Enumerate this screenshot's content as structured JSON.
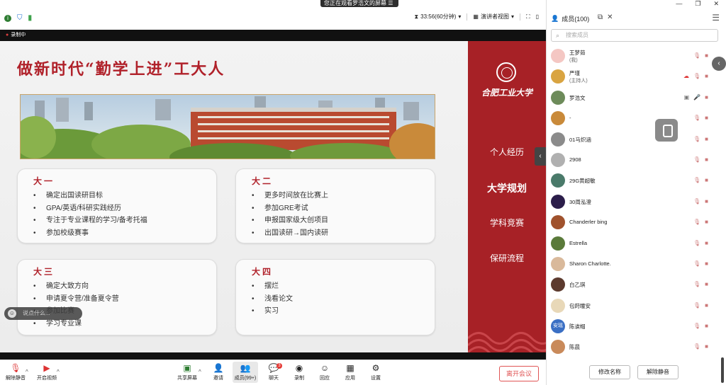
{
  "top": {
    "share_banner": "您正在观看罗浩文的屏幕",
    "duration": "33:56(60分钟)",
    "view_mode": "演讲者视图"
  },
  "recording": {
    "label": "录制中"
  },
  "slide": {
    "title": "做新时代“勤学上进”工大人",
    "university": "合肥工业大学",
    "nav": [
      "个人经历",
      "大学规划",
      "学科竞赛",
      "保研流程"
    ],
    "cards": [
      {
        "heading": "大一",
        "items": [
          "确定出国读研目标",
          "GPA/英语/科研实践经历",
          "专注于专业课程的学习/备考托福",
          "参加校级赛事"
        ]
      },
      {
        "heading": "大二",
        "items": [
          "更多时间放在比赛上",
          "参加GRE考试",
          "申报国家级大创项目",
          "出国读研→国内读研"
        ]
      },
      {
        "heading": "大三",
        "items": [
          "确定大致方向",
          "申请夏令营/准备夏令营",
          "参加比赛",
          "学习专业课"
        ]
      },
      {
        "heading": "大四",
        "items": [
          "摆烂",
          "浅看论文",
          "实习"
        ]
      }
    ]
  },
  "chat_input": {
    "placeholder": "说点什么..."
  },
  "toolbar": {
    "mute": "解除静音",
    "video": "开启视频",
    "share": "共享屏幕",
    "invite": "邀请",
    "members": "成员(99+)",
    "chat": "聊天",
    "chat_badge": "3",
    "record": "录制",
    "react": "回应",
    "apps": "应用",
    "settings": "设置",
    "leave": "离开会议"
  },
  "panel": {
    "title": "成员(100)",
    "search_placeholder": "搜索成员",
    "members": [
      {
        "name": "王梦茹",
        "sub": "(我)",
        "avatar_color": "#f4c7c3"
      },
      {
        "name": "严瑾",
        "sub": "(主持人)",
        "avatar_color": "#d9a441"
      },
      {
        "name": "罗浩文",
        "sub": "",
        "avatar_color": "#6d8b5a"
      },
      {
        "name": "-",
        "sub": "",
        "avatar_color": "#c98a3a"
      },
      {
        "name": "01马炽涵",
        "sub": "",
        "avatar_color": "#8b8b8b"
      },
      {
        "name": "2908",
        "sub": "",
        "avatar_color": "#b0b0b0"
      },
      {
        "name": "29G黄超敏",
        "sub": "",
        "avatar_color": "#4a7a6a"
      },
      {
        "name": "30周泓澄",
        "sub": "",
        "avatar_color": "#2b1d4a"
      },
      {
        "name": "Chanderler bing",
        "sub": "",
        "avatar_color": "#a0522d"
      },
      {
        "name": "Estrella",
        "sub": "",
        "avatar_color": "#5a7a3a"
      },
      {
        "name": "Sharon Charlotte.",
        "sub": "",
        "avatar_color": "#d9b99b"
      },
      {
        "name": "白乙琪",
        "sub": "",
        "avatar_color": "#5c3a2e"
      },
      {
        "name": "包莳瞳安",
        "sub": "",
        "avatar_color": "#e8d8b8"
      },
      {
        "name": "陈诶帽",
        "sub": "",
        "avatar_color": "#3a6fc4",
        "avatar_text": "安瑶"
      },
      {
        "name": "陈晨",
        "sub": "",
        "avatar_color": "#c98a5a"
      }
    ],
    "rename": "修改名称",
    "unmute": "解除静音"
  }
}
